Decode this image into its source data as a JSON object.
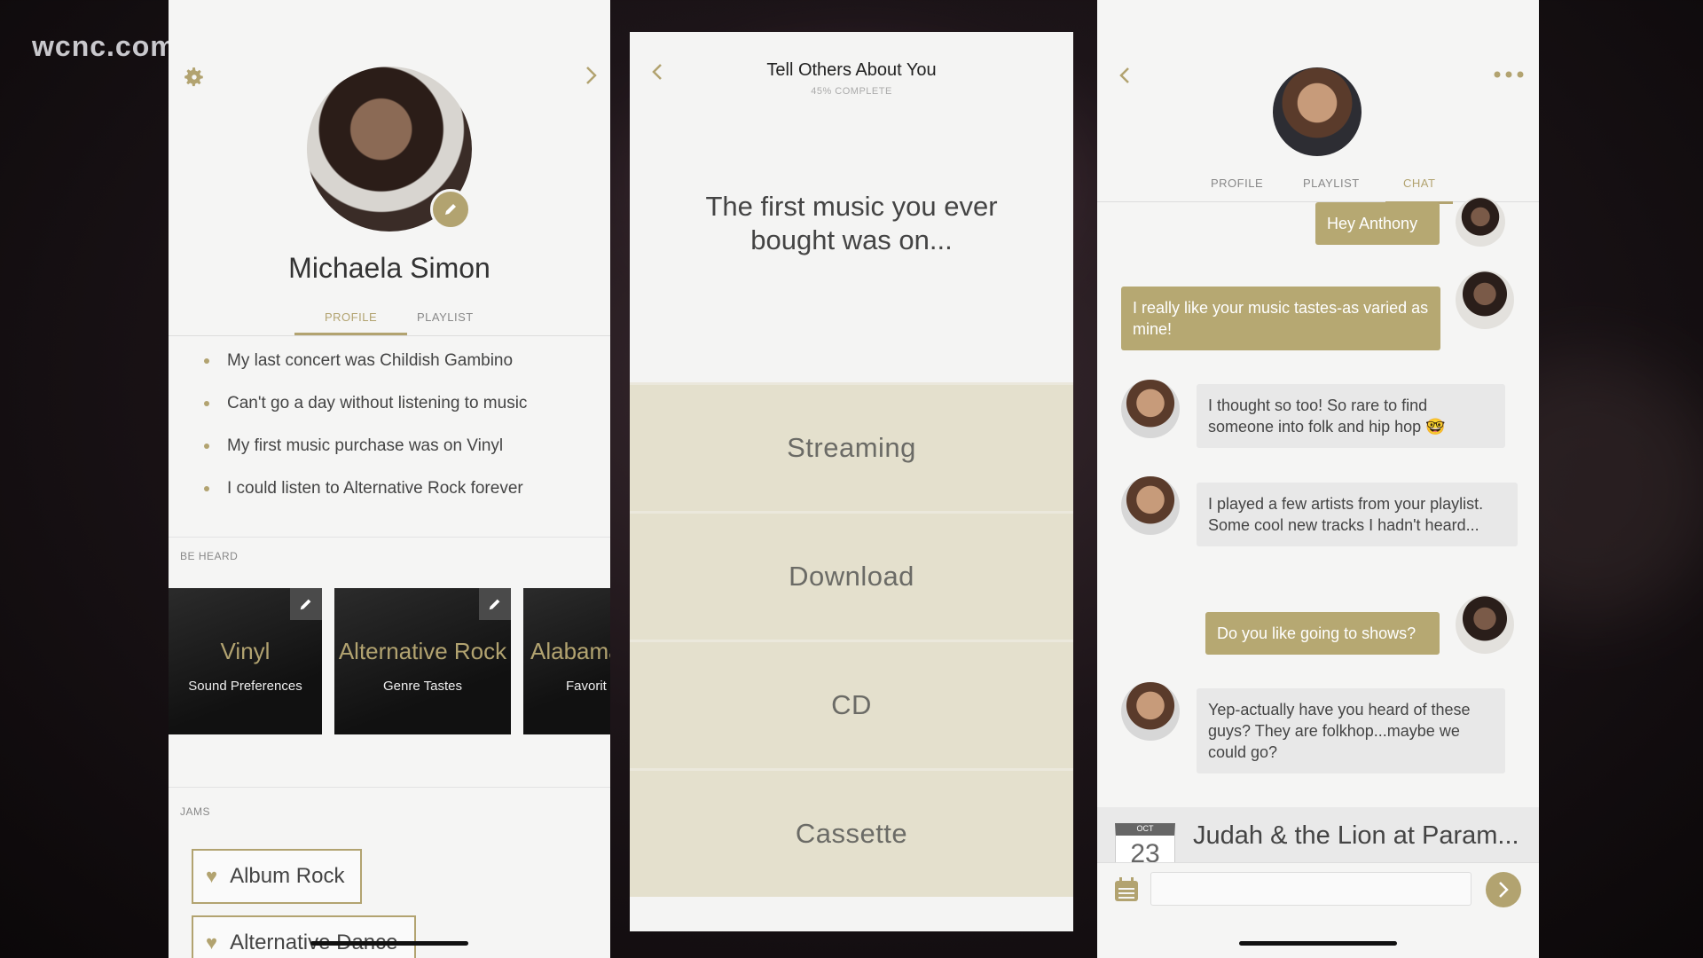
{
  "watermark": "wcnc.com",
  "colors": {
    "accent": "#b2a370",
    "option_bg": "#e4e0cd",
    "bubble_me": "#b6a872",
    "bubble_them": "#e8e8e8"
  },
  "profile": {
    "name": "Michaela Simon",
    "tabs": [
      "PROFILE",
      "PLAYLIST"
    ],
    "active_tab": "PROFILE",
    "facts": [
      "My last concert was Childish Gambino",
      "Can't go a day without listening to music",
      "My first music purchase was on Vinyl",
      "I could listen to Alternative Rock forever"
    ],
    "be_heard_label": "BE HEARD",
    "cards": [
      {
        "title": "Vinyl",
        "subtitle": "Sound Preferences"
      },
      {
        "title": "Alternative Rock",
        "subtitle": "Genre Tastes"
      },
      {
        "title": "Alabama",
        "subtitle": "Favorit"
      }
    ],
    "jams_label": "JAMS",
    "jams": [
      "Album Rock",
      "Alternative Dance"
    ]
  },
  "onboarding": {
    "title": "Tell Others About You",
    "progress_label": "45% COMPLETE",
    "progress_percent": 45,
    "question": "The first music you ever bought was on...",
    "options": [
      "Streaming",
      "Download",
      "CD",
      "Cassette"
    ]
  },
  "chat": {
    "tabs": [
      "PROFILE",
      "PLAYLIST",
      "CHAT"
    ],
    "active_tab": "CHAT",
    "messages": [
      {
        "from": "me",
        "text": "Hey Anthony"
      },
      {
        "from": "me",
        "text": "I really like your music tastes-as varied as mine!"
      },
      {
        "from": "them",
        "text": "I thought so too! So rare to find someone into folk and hip hop 🤓"
      },
      {
        "from": "them",
        "text": "I played a few artists from your playlist. Some cool new tracks I hadn't heard..."
      },
      {
        "from": "me",
        "text": "Do you like going to shows?"
      },
      {
        "from": "them",
        "text": "Yep-actually have you heard of these guys? They are folkhop...maybe we could  go?"
      }
    ],
    "event": {
      "month": "OCT",
      "day": "23",
      "title": "Judah & the Lion at Param..."
    },
    "input": {
      "value": "",
      "placeholder": ""
    }
  }
}
